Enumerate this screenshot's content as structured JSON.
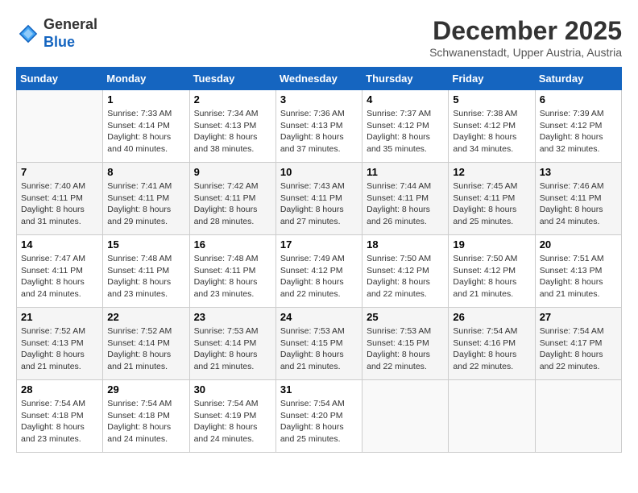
{
  "logo": {
    "general": "General",
    "blue": "Blue"
  },
  "header": {
    "month": "December 2025",
    "location": "Schwanenstadt, Upper Austria, Austria"
  },
  "weekdays": [
    "Sunday",
    "Monday",
    "Tuesday",
    "Wednesday",
    "Thursday",
    "Friday",
    "Saturday"
  ],
  "weeks": [
    [
      {
        "day": "",
        "info": ""
      },
      {
        "day": "1",
        "info": "Sunrise: 7:33 AM\nSunset: 4:14 PM\nDaylight: 8 hours\nand 40 minutes."
      },
      {
        "day": "2",
        "info": "Sunrise: 7:34 AM\nSunset: 4:13 PM\nDaylight: 8 hours\nand 38 minutes."
      },
      {
        "day": "3",
        "info": "Sunrise: 7:36 AM\nSunset: 4:13 PM\nDaylight: 8 hours\nand 37 minutes."
      },
      {
        "day": "4",
        "info": "Sunrise: 7:37 AM\nSunset: 4:12 PM\nDaylight: 8 hours\nand 35 minutes."
      },
      {
        "day": "5",
        "info": "Sunrise: 7:38 AM\nSunset: 4:12 PM\nDaylight: 8 hours\nand 34 minutes."
      },
      {
        "day": "6",
        "info": "Sunrise: 7:39 AM\nSunset: 4:12 PM\nDaylight: 8 hours\nand 32 minutes."
      }
    ],
    [
      {
        "day": "7",
        "info": "Sunrise: 7:40 AM\nSunset: 4:11 PM\nDaylight: 8 hours\nand 31 minutes."
      },
      {
        "day": "8",
        "info": "Sunrise: 7:41 AM\nSunset: 4:11 PM\nDaylight: 8 hours\nand 29 minutes."
      },
      {
        "day": "9",
        "info": "Sunrise: 7:42 AM\nSunset: 4:11 PM\nDaylight: 8 hours\nand 28 minutes."
      },
      {
        "day": "10",
        "info": "Sunrise: 7:43 AM\nSunset: 4:11 PM\nDaylight: 8 hours\nand 27 minutes."
      },
      {
        "day": "11",
        "info": "Sunrise: 7:44 AM\nSunset: 4:11 PM\nDaylight: 8 hours\nand 26 minutes."
      },
      {
        "day": "12",
        "info": "Sunrise: 7:45 AM\nSunset: 4:11 PM\nDaylight: 8 hours\nand 25 minutes."
      },
      {
        "day": "13",
        "info": "Sunrise: 7:46 AM\nSunset: 4:11 PM\nDaylight: 8 hours\nand 24 minutes."
      }
    ],
    [
      {
        "day": "14",
        "info": "Sunrise: 7:47 AM\nSunset: 4:11 PM\nDaylight: 8 hours\nand 24 minutes."
      },
      {
        "day": "15",
        "info": "Sunrise: 7:48 AM\nSunset: 4:11 PM\nDaylight: 8 hours\nand 23 minutes."
      },
      {
        "day": "16",
        "info": "Sunrise: 7:48 AM\nSunset: 4:11 PM\nDaylight: 8 hours\nand 23 minutes."
      },
      {
        "day": "17",
        "info": "Sunrise: 7:49 AM\nSunset: 4:12 PM\nDaylight: 8 hours\nand 22 minutes."
      },
      {
        "day": "18",
        "info": "Sunrise: 7:50 AM\nSunset: 4:12 PM\nDaylight: 8 hours\nand 22 minutes."
      },
      {
        "day": "19",
        "info": "Sunrise: 7:50 AM\nSunset: 4:12 PM\nDaylight: 8 hours\nand 21 minutes."
      },
      {
        "day": "20",
        "info": "Sunrise: 7:51 AM\nSunset: 4:13 PM\nDaylight: 8 hours\nand 21 minutes."
      }
    ],
    [
      {
        "day": "21",
        "info": "Sunrise: 7:52 AM\nSunset: 4:13 PM\nDaylight: 8 hours\nand 21 minutes."
      },
      {
        "day": "22",
        "info": "Sunrise: 7:52 AM\nSunset: 4:14 PM\nDaylight: 8 hours\nand 21 minutes."
      },
      {
        "day": "23",
        "info": "Sunrise: 7:53 AM\nSunset: 4:14 PM\nDaylight: 8 hours\nand 21 minutes."
      },
      {
        "day": "24",
        "info": "Sunrise: 7:53 AM\nSunset: 4:15 PM\nDaylight: 8 hours\nand 21 minutes."
      },
      {
        "day": "25",
        "info": "Sunrise: 7:53 AM\nSunset: 4:15 PM\nDaylight: 8 hours\nand 22 minutes."
      },
      {
        "day": "26",
        "info": "Sunrise: 7:54 AM\nSunset: 4:16 PM\nDaylight: 8 hours\nand 22 minutes."
      },
      {
        "day": "27",
        "info": "Sunrise: 7:54 AM\nSunset: 4:17 PM\nDaylight: 8 hours\nand 22 minutes."
      }
    ],
    [
      {
        "day": "28",
        "info": "Sunrise: 7:54 AM\nSunset: 4:18 PM\nDaylight: 8 hours\nand 23 minutes."
      },
      {
        "day": "29",
        "info": "Sunrise: 7:54 AM\nSunset: 4:18 PM\nDaylight: 8 hours\nand 24 minutes."
      },
      {
        "day": "30",
        "info": "Sunrise: 7:54 AM\nSunset: 4:19 PM\nDaylight: 8 hours\nand 24 minutes."
      },
      {
        "day": "31",
        "info": "Sunrise: 7:54 AM\nSunset: 4:20 PM\nDaylight: 8 hours\nand 25 minutes."
      },
      {
        "day": "",
        "info": ""
      },
      {
        "day": "",
        "info": ""
      },
      {
        "day": "",
        "info": ""
      }
    ]
  ]
}
